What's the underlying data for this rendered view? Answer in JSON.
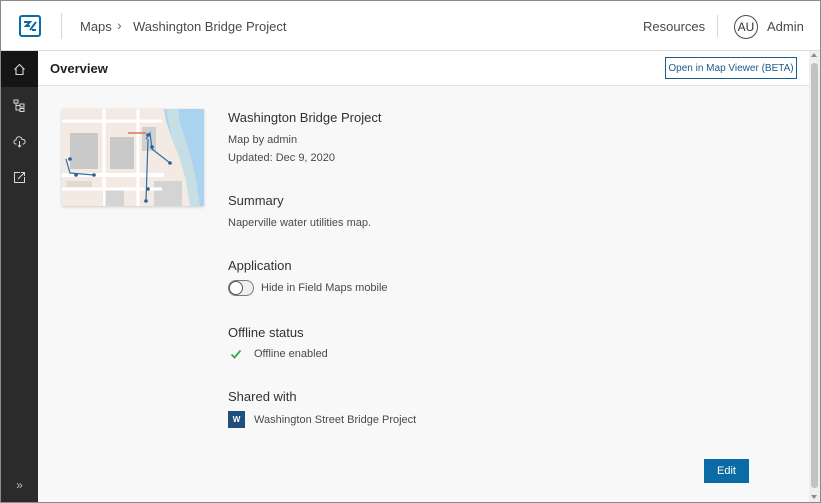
{
  "header": {
    "breadcrumb_root": "Maps",
    "breadcrumb_separator": "›",
    "breadcrumb_current": "Washington Bridge Project",
    "resources_label": "Resources",
    "avatar_initials": "AU",
    "username": "Admin"
  },
  "rail": {
    "items": [
      {
        "icon": "home-icon",
        "active": true
      },
      {
        "icon": "layers-tree-icon",
        "active": false
      },
      {
        "icon": "cloud-download-icon",
        "active": false
      },
      {
        "icon": "share-export-icon",
        "active": false
      }
    ],
    "expand_label": "»"
  },
  "overview": {
    "title": "Overview",
    "open_button_label": "Open in Map Viewer (BETA)"
  },
  "map": {
    "title": "Washington Bridge Project",
    "owner": "Map by admin",
    "updated": "Updated: Dec 9, 2020"
  },
  "summary": {
    "heading": "Summary",
    "text": "Naperville water utilities map."
  },
  "application": {
    "heading": "Application",
    "toggle_label": "Hide in Field Maps mobile",
    "toggle_on": false
  },
  "offline": {
    "heading": "Offline status",
    "status_text": "Offline enabled"
  },
  "shared": {
    "heading": "Shared with",
    "groups": [
      {
        "badge": "W",
        "name": "Washington Street Bridge Project"
      }
    ]
  },
  "actions": {
    "edit_label": "Edit"
  },
  "colors": {
    "accent": "#0b6ba5",
    "rail_bg": "#2b2b2b",
    "success": "#35ac46",
    "group_badge": "#1f4f7a"
  }
}
